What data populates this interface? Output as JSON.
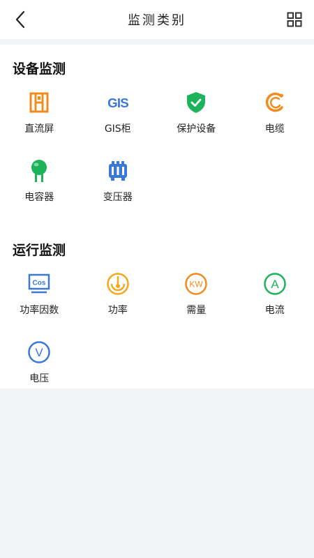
{
  "header": {
    "title": "监测类别",
    "back_icon": "chevron-left-icon",
    "grid_icon": "grid-icon"
  },
  "sections": [
    {
      "title": "设备监测",
      "items": [
        {
          "label": "直流屏",
          "icon": "dc-panel-icon",
          "color": "#f08c1e"
        },
        {
          "label": "GIS柜",
          "icon": "gis-icon",
          "color": "#3a78d8"
        },
        {
          "label": "保护设备",
          "icon": "shield-check-icon",
          "color": "#1db35a"
        },
        {
          "label": "电缆",
          "icon": "cable-icon",
          "color": "#f08c1e"
        },
        {
          "label": "电容器",
          "icon": "capacitor-icon",
          "color": "#1db35a"
        },
        {
          "label": "变压器",
          "icon": "transformer-icon",
          "color": "#3a78d8"
        }
      ]
    },
    {
      "title": "运行监测",
      "items": [
        {
          "label": "功率因数",
          "icon": "cos-icon",
          "color": "#3a78d8",
          "glyph": "Cos"
        },
        {
          "label": "功率",
          "icon": "power-gauge-icon",
          "color": "#f0a81e"
        },
        {
          "label": "需量",
          "icon": "kw-icon",
          "color": "#f08c1e",
          "glyph": "KW"
        },
        {
          "label": "电流",
          "icon": "ampere-icon",
          "color": "#1db35a",
          "glyph": "A"
        },
        {
          "label": "电压",
          "icon": "volt-icon",
          "color": "#3a78d8",
          "glyph": "V"
        }
      ]
    }
  ]
}
